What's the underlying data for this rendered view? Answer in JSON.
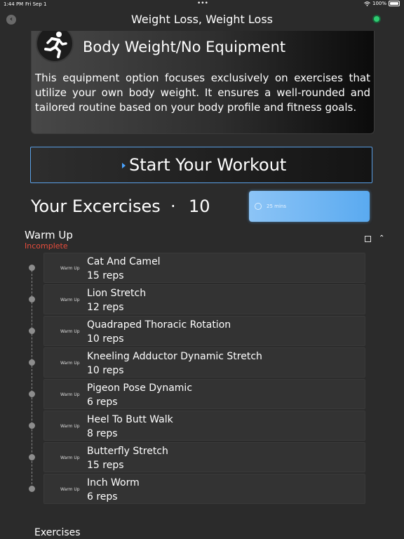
{
  "status_bar": {
    "time": "1:44 PM",
    "date": "Fri Sep 1",
    "battery": "100%"
  },
  "header": {
    "title": "Weight Loss, Weight Loss"
  },
  "card": {
    "title": "Body Weight/No Equipment",
    "description": "This equipment option focuses exclusively on exercises that utilize your own body weight. It ensures a well-rounded and tailored routine based on your body profile and fitness goals."
  },
  "start_button": {
    "label": "Start Your Workout"
  },
  "exercises_header": {
    "title": "Your Excercises",
    "separator": "·",
    "count": "10"
  },
  "duration": {
    "label": "25 mins"
  },
  "warmup_section": {
    "title": "Warm Up",
    "status": "Incomplete"
  },
  "exercises": [
    {
      "tag": "Warm Up",
      "name": "Cat And Camel",
      "reps": "15 reps"
    },
    {
      "tag": "Warm Up",
      "name": "Lion Stretch",
      "reps": "12 reps"
    },
    {
      "tag": "Warm Up",
      "name": "Quadraped Thoracic Rotation",
      "reps": "10 reps"
    },
    {
      "tag": "Warm Up",
      "name": "Kneeling Adductor Dynamic Stretch",
      "reps": "10 reps"
    },
    {
      "tag": "Warm Up",
      "name": "Pigeon Pose Dynamic",
      "reps": "6 reps"
    },
    {
      "tag": "Warm Up",
      "name": "Heel To Butt Walk",
      "reps": "8 reps"
    },
    {
      "tag": "Warm Up",
      "name": "Butterfly Stretch",
      "reps": "15 reps"
    },
    {
      "tag": "Warm Up",
      "name": "Inch Worm",
      "reps": "6 reps"
    }
  ],
  "next_section": {
    "title": "Exercises"
  },
  "colors": {
    "accent": "#5aaaf0",
    "incomplete": "#e74c3c",
    "online": "#2ecc71"
  }
}
